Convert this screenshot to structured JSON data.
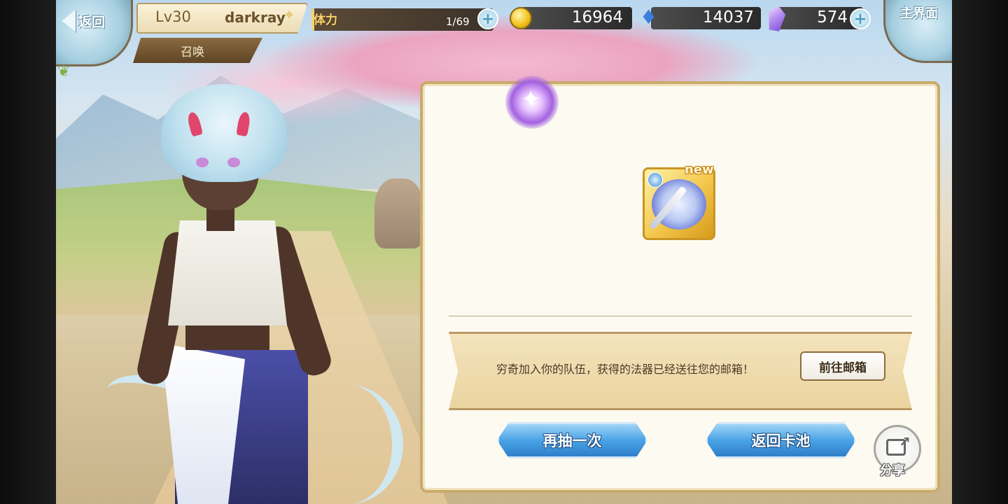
{
  "nav": {
    "back_label": "返回",
    "home_label": "主界面"
  },
  "player": {
    "level": "Lv30",
    "name": "darkray",
    "section_tab": "召唤"
  },
  "resources": {
    "stamina_label": "体力",
    "stamina_value": "1/69",
    "stamina_fraction": 0.0145,
    "gold": "16964",
    "spirit": "14037",
    "crystal": "574"
  },
  "result": {
    "new_tag": "new",
    "item_icon": "sword-artifact-icon",
    "message": "穷奇加入你的队伍，获得的法器已经送往您的邮箱！",
    "mailbox_button": "前往邮箱",
    "draw_again_button": "再抽一次",
    "back_to_pool_button": "返回卡池",
    "share_label": "分享"
  },
  "colors": {
    "accent_blue": "#4aa3e6",
    "gold_frame": "#c9ab6c",
    "item_gold": "#f2c64a"
  }
}
